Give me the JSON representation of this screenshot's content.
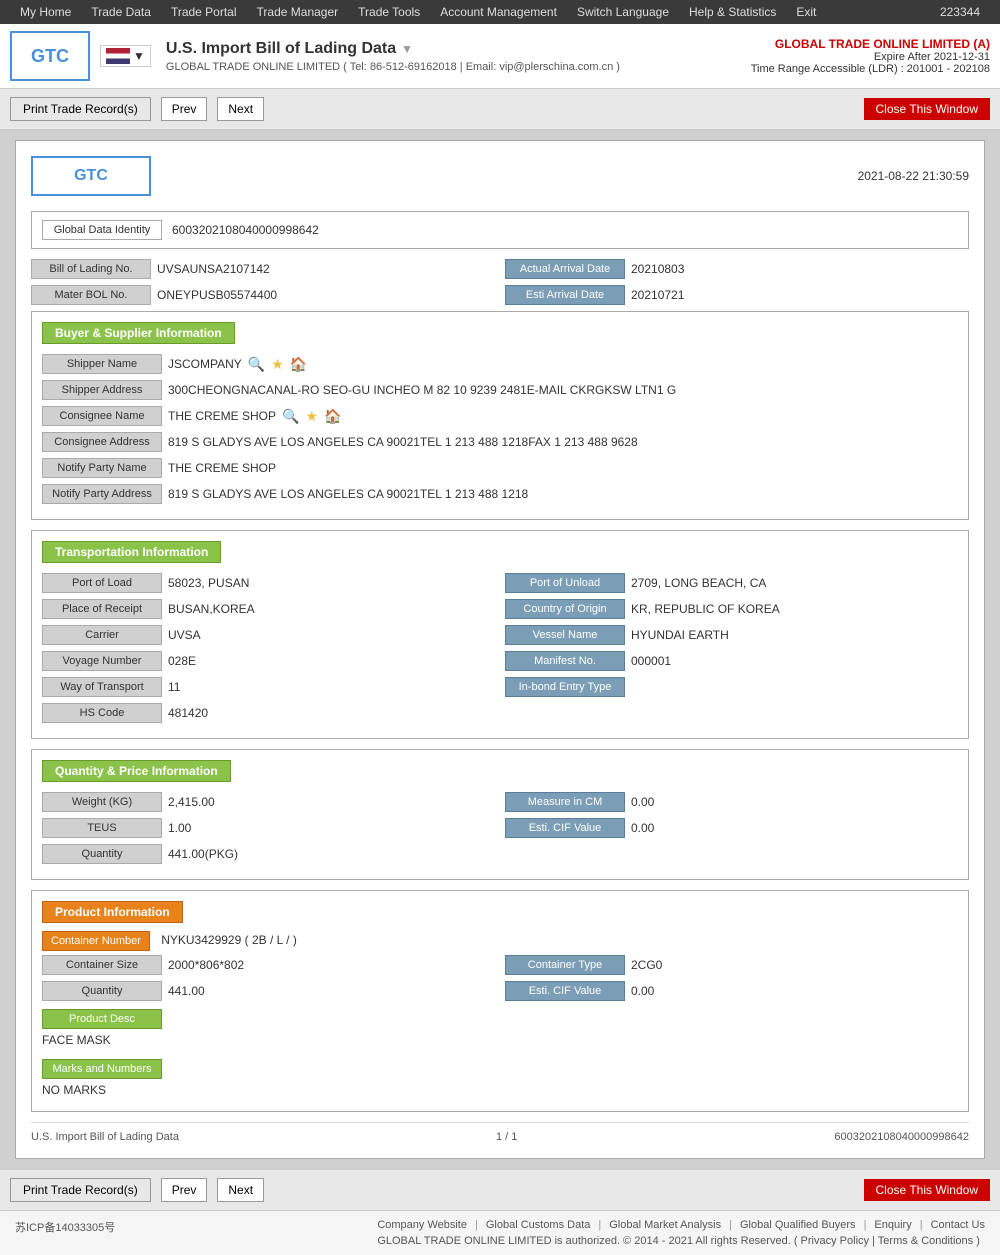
{
  "topnav": {
    "items": [
      {
        "label": "My Home"
      },
      {
        "label": "Trade Data"
      },
      {
        "label": "Trade Portal"
      },
      {
        "label": "Trade Manager"
      },
      {
        "label": "Trade Tools"
      },
      {
        "label": "Account Management"
      },
      {
        "label": "Switch Language"
      },
      {
        "label": "Help & Statistics"
      },
      {
        "label": "Exit"
      }
    ],
    "user_id": "223344"
  },
  "header": {
    "logo": "GTC",
    "page_title": "U.S. Import Bill of Lading Data",
    "page_title_arrow": "▼",
    "subtitle_company": "GLOBAL TRADE ONLINE LIMITED",
    "subtitle_tel": "Tel: 86-512-69162018",
    "subtitle_email": "Email: vip@plerschina.com.cn",
    "company_name": "GLOBAL TRADE ONLINE LIMITED (A)",
    "expire_label": "Expire After 2021-12-31",
    "time_range": "Time Range Accessible (LDR) : 201001 - 202108"
  },
  "toolbar": {
    "print_label": "Print Trade Record(s)",
    "prev_label": "Prev",
    "next_label": "Next",
    "close_label": "Close This Window"
  },
  "record": {
    "logo": "GTC",
    "date": "2021-08-22 21:30:59",
    "global_data_id_label": "Global Data Identity",
    "global_data_id_value": "6003202108040000998642",
    "bol_no_label": "Bill of Lading No.",
    "bol_no_value": "UVSAUNSA2107142",
    "actual_arrival_label": "Actual Arrival Date",
    "actual_arrival_value": "20210803",
    "mater_bol_label": "Mater BOL No.",
    "mater_bol_value": "ONEYPUSB05574400",
    "esti_arrival_label": "Esti Arrival Date",
    "esti_arrival_value": "20210721",
    "buyer_supplier_title": "Buyer & Supplier Information",
    "shipper_name_label": "Shipper Name",
    "shipper_name_value": "JSCOMPANY",
    "shipper_address_label": "Shipper Address",
    "shipper_address_value": "300CHEONGNACANAL-RO SEO-GU INCHEO M 82 10 9239 2481E-MAIL CKRGKSW LTN1 G",
    "consignee_name_label": "Consignee Name",
    "consignee_name_value": "THE CREME SHOP",
    "consignee_address_label": "Consignee Address",
    "consignee_address_value": "819 S GLADYS AVE LOS ANGELES CA 90021TEL 1 213 488 1218FAX 1 213 488 9628",
    "notify_party_name_label": "Notify Party Name",
    "notify_party_name_value": "THE CREME SHOP",
    "notify_party_address_label": "Notify Party Address",
    "notify_party_address_value": "819 S GLADYS AVE LOS ANGELES CA 90021TEL 1 213 488 1218",
    "transport_title": "Transportation Information",
    "port_of_load_label": "Port of Load",
    "port_of_load_value": "58023, PUSAN",
    "port_of_unload_label": "Port of Unload",
    "port_of_unload_value": "2709, LONG BEACH, CA",
    "place_of_receipt_label": "Place of Receipt",
    "place_of_receipt_value": "BUSAN,KOREA",
    "country_of_origin_label": "Country of Origin",
    "country_of_origin_value": "KR, REPUBLIC OF KOREA",
    "carrier_label": "Carrier",
    "carrier_value": "UVSA",
    "vessel_name_label": "Vessel Name",
    "vessel_name_value": "HYUNDAI EARTH",
    "voyage_number_label": "Voyage Number",
    "voyage_number_value": "028E",
    "manifest_no_label": "Manifest No.",
    "manifest_no_value": "000001",
    "way_of_transport_label": "Way of Transport",
    "way_of_transport_value": "11",
    "in_bond_entry_label": "In-bond Entry Type",
    "in_bond_entry_value": "",
    "hs_code_label": "HS Code",
    "hs_code_value": "481420",
    "qty_price_title": "Quantity & Price Information",
    "weight_kg_label": "Weight (KG)",
    "weight_kg_value": "2,415.00",
    "measure_cm_label": "Measure in CM",
    "measure_cm_value": "0.00",
    "teus_label": "TEUS",
    "teus_value": "1.00",
    "esti_cif_label": "Esti. CIF Value",
    "esti_cif_value": "0.00",
    "quantity_label": "Quantity",
    "quantity_value": "441.00(PKG)",
    "product_title": "Product Information",
    "container_number_label": "Container Number",
    "container_number_value": "NYKU3429929 ( 2B / L / )",
    "container_size_label": "Container Size",
    "container_size_value": "2000*806*802",
    "container_type_label": "Container Type",
    "container_type_value": "2CG0",
    "quantity2_label": "Quantity",
    "quantity2_value": "441.00",
    "esti_cif2_label": "Esti. CIF Value",
    "esti_cif2_value": "0.00",
    "product_desc_label": "Product Desc",
    "product_desc_value": "FACE MASK",
    "marks_numbers_label": "Marks and Numbers",
    "marks_numbers_value": "NO MARKS",
    "footer_title": "U.S. Import Bill of Lading Data",
    "footer_page": "1 / 1",
    "footer_id": "6003202108040000998642"
  },
  "site_footer": {
    "icp": "苏ICP备14033305号",
    "links": [
      {
        "label": "Company Website"
      },
      {
        "label": "Global Customs Data"
      },
      {
        "label": "Global Market Analysis"
      },
      {
        "label": "Global Qualified Buyers"
      },
      {
        "label": "Enquiry"
      },
      {
        "label": "Contact Us"
      }
    ],
    "copyright": "GLOBAL TRADE ONLINE LIMITED is authorized. © 2014 - 2021 All rights Reserved.",
    "privacy_policy": "Privacy Policy",
    "terms": "Terms & Conditions"
  }
}
